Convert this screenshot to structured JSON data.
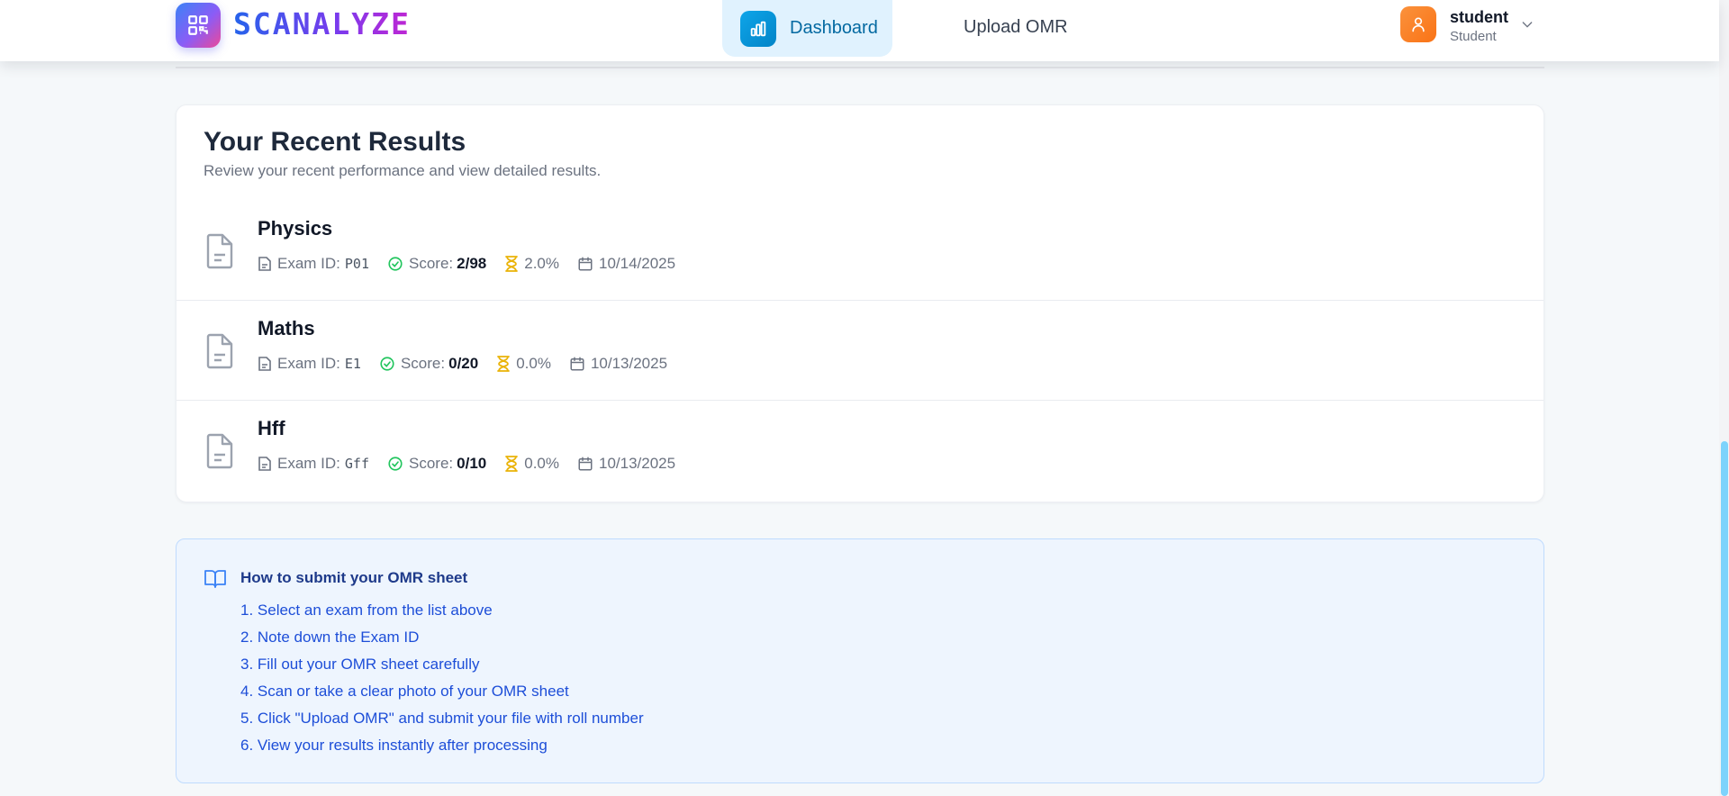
{
  "header": {
    "brand": "SCANALYZE",
    "nav": {
      "dashboard_label": "Dashboard",
      "upload_label": "Upload OMR"
    },
    "user": {
      "name": "student",
      "role": "Student"
    }
  },
  "results": {
    "title": "Your Recent Results",
    "subtitle": "Review your recent performance and view detailed results.",
    "exam_id_label": "Exam ID:",
    "score_label": "Score:",
    "items": [
      {
        "name": "Physics",
        "exam_id": "P01",
        "score": "2/98",
        "percent": "2.0%",
        "date": "10/14/2025"
      },
      {
        "name": "Maths",
        "exam_id": "E1",
        "score": "0/20",
        "percent": "0.0%",
        "date": "10/13/2025"
      },
      {
        "name": "Hff",
        "exam_id": "Gff",
        "score": "0/10",
        "percent": "0.0%",
        "date": "10/13/2025"
      }
    ]
  },
  "instructions": {
    "title": "How to submit your OMR sheet",
    "steps": [
      "1. Select an exam from the list above",
      "2. Note down the Exam ID",
      "3. Fill out your OMR sheet carefully",
      "4. Scan or take a clear photo of your OMR sheet",
      "5. Click \"Upload OMR\" and submit your file with roll number",
      "6. View your results instantly after processing"
    ]
  },
  "colors": {
    "accent": "#0284c7",
    "success": "#22c55e",
    "warning": "#eab308",
    "avatar": "#f97316",
    "info_background": "#eef5fe"
  },
  "icons": [
    "qr-code-icon",
    "bar-chart-icon",
    "user-icon",
    "chevron-down-icon",
    "document-icon",
    "file-text-icon",
    "check-circle-icon",
    "hourglass-icon",
    "calendar-icon",
    "book-open-icon"
  ]
}
